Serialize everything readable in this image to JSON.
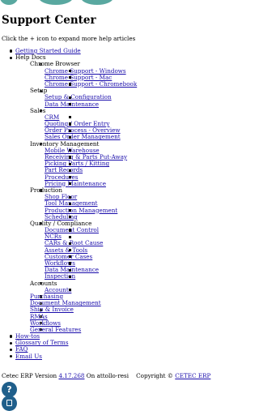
{
  "header": {
    "title": "Support Center"
  },
  "intro": "Click the + icon to expand more help articles",
  "nav": {
    "getting_started": "Getting Started Guide",
    "help_docs": "Help Docs",
    "chrome_browser": {
      "label": "Chrome Browser",
      "items": [
        "Chrome Support - Windows",
        "Chrome Support - Mac",
        "Chrome Support - Chromebook"
      ]
    },
    "setup": {
      "label": "Setup",
      "items": [
        "Setup & Configuration",
        "Data Maintenance"
      ]
    },
    "sales": {
      "label": "Sales",
      "items": [
        "CRM",
        "Quoting / Order Entry",
        "Order Process - Overview",
        "Sales Order Management"
      ]
    },
    "inventory": {
      "label": "Inventory Management",
      "items": [
        "Mobile Warehouse",
        "Receiving & Parts Put-Away",
        "Picking Parts / Kitting",
        "Part Records",
        "Procedures",
        "Pricing Maintenance"
      ]
    },
    "production": {
      "label": "Production",
      "items": [
        "Shop Floor",
        "Tool Management",
        "Production Management",
        "Scheduling"
      ]
    },
    "quality": {
      "label": "Quality / Compliance",
      "items": [
        "Document Control",
        "NCRs",
        "CARs & Root Cause",
        "Assets & Tools",
        "Customer Cases",
        "Workflows",
        "Data Maintenance",
        "Inspection"
      ]
    },
    "accounts": {
      "label": "Accounts",
      "items": [
        "Accounts"
      ]
    },
    "other_docs": [
      "Purchasing",
      "Document Management",
      "Ship & Invoice",
      "RMAs",
      "Workflows",
      "General Features"
    ],
    "bottom": [
      "How-tos",
      "Glossary of Terms",
      "FAQ",
      "Email Us"
    ]
  },
  "footer": {
    "prefix": "Cetec ERP Version",
    "version": "4.17.268",
    "server": "On attollo-resi",
    "copyright": "Copyright ©",
    "company": "CETEC ERP"
  },
  "widgets": {
    "help_glyph": "?",
    "help_icon": "help-icon",
    "chat_icon": "chat-icon"
  },
  "colors": {
    "link": "#1a0dab",
    "widget": "#1f5f8b",
    "logo": "#59a8a0"
  }
}
